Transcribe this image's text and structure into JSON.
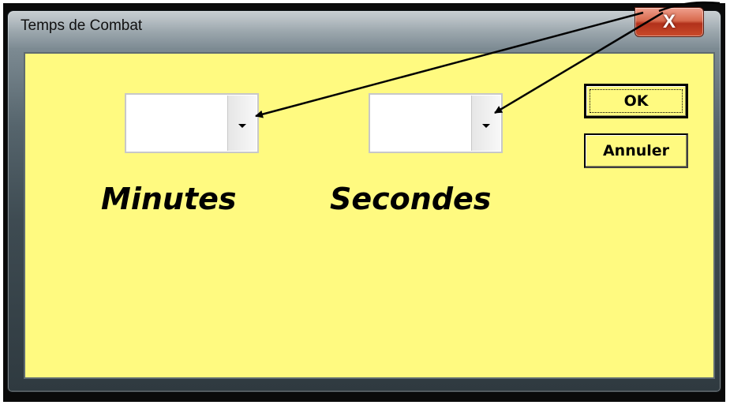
{
  "window": {
    "title": "Temps de Combat",
    "close_label": "X"
  },
  "form": {
    "minutes_combo": {
      "value": ""
    },
    "seconds_combo": {
      "value": ""
    },
    "minutes_label": "Minutes",
    "seconds_label": "Secondes"
  },
  "buttons": {
    "ok_label": "OK",
    "cancel_label": "Annuler"
  },
  "colors": {
    "client_background": "#fffa80",
    "close_button": "#c94a2a"
  },
  "annotation": {
    "arrow_count": 2
  }
}
